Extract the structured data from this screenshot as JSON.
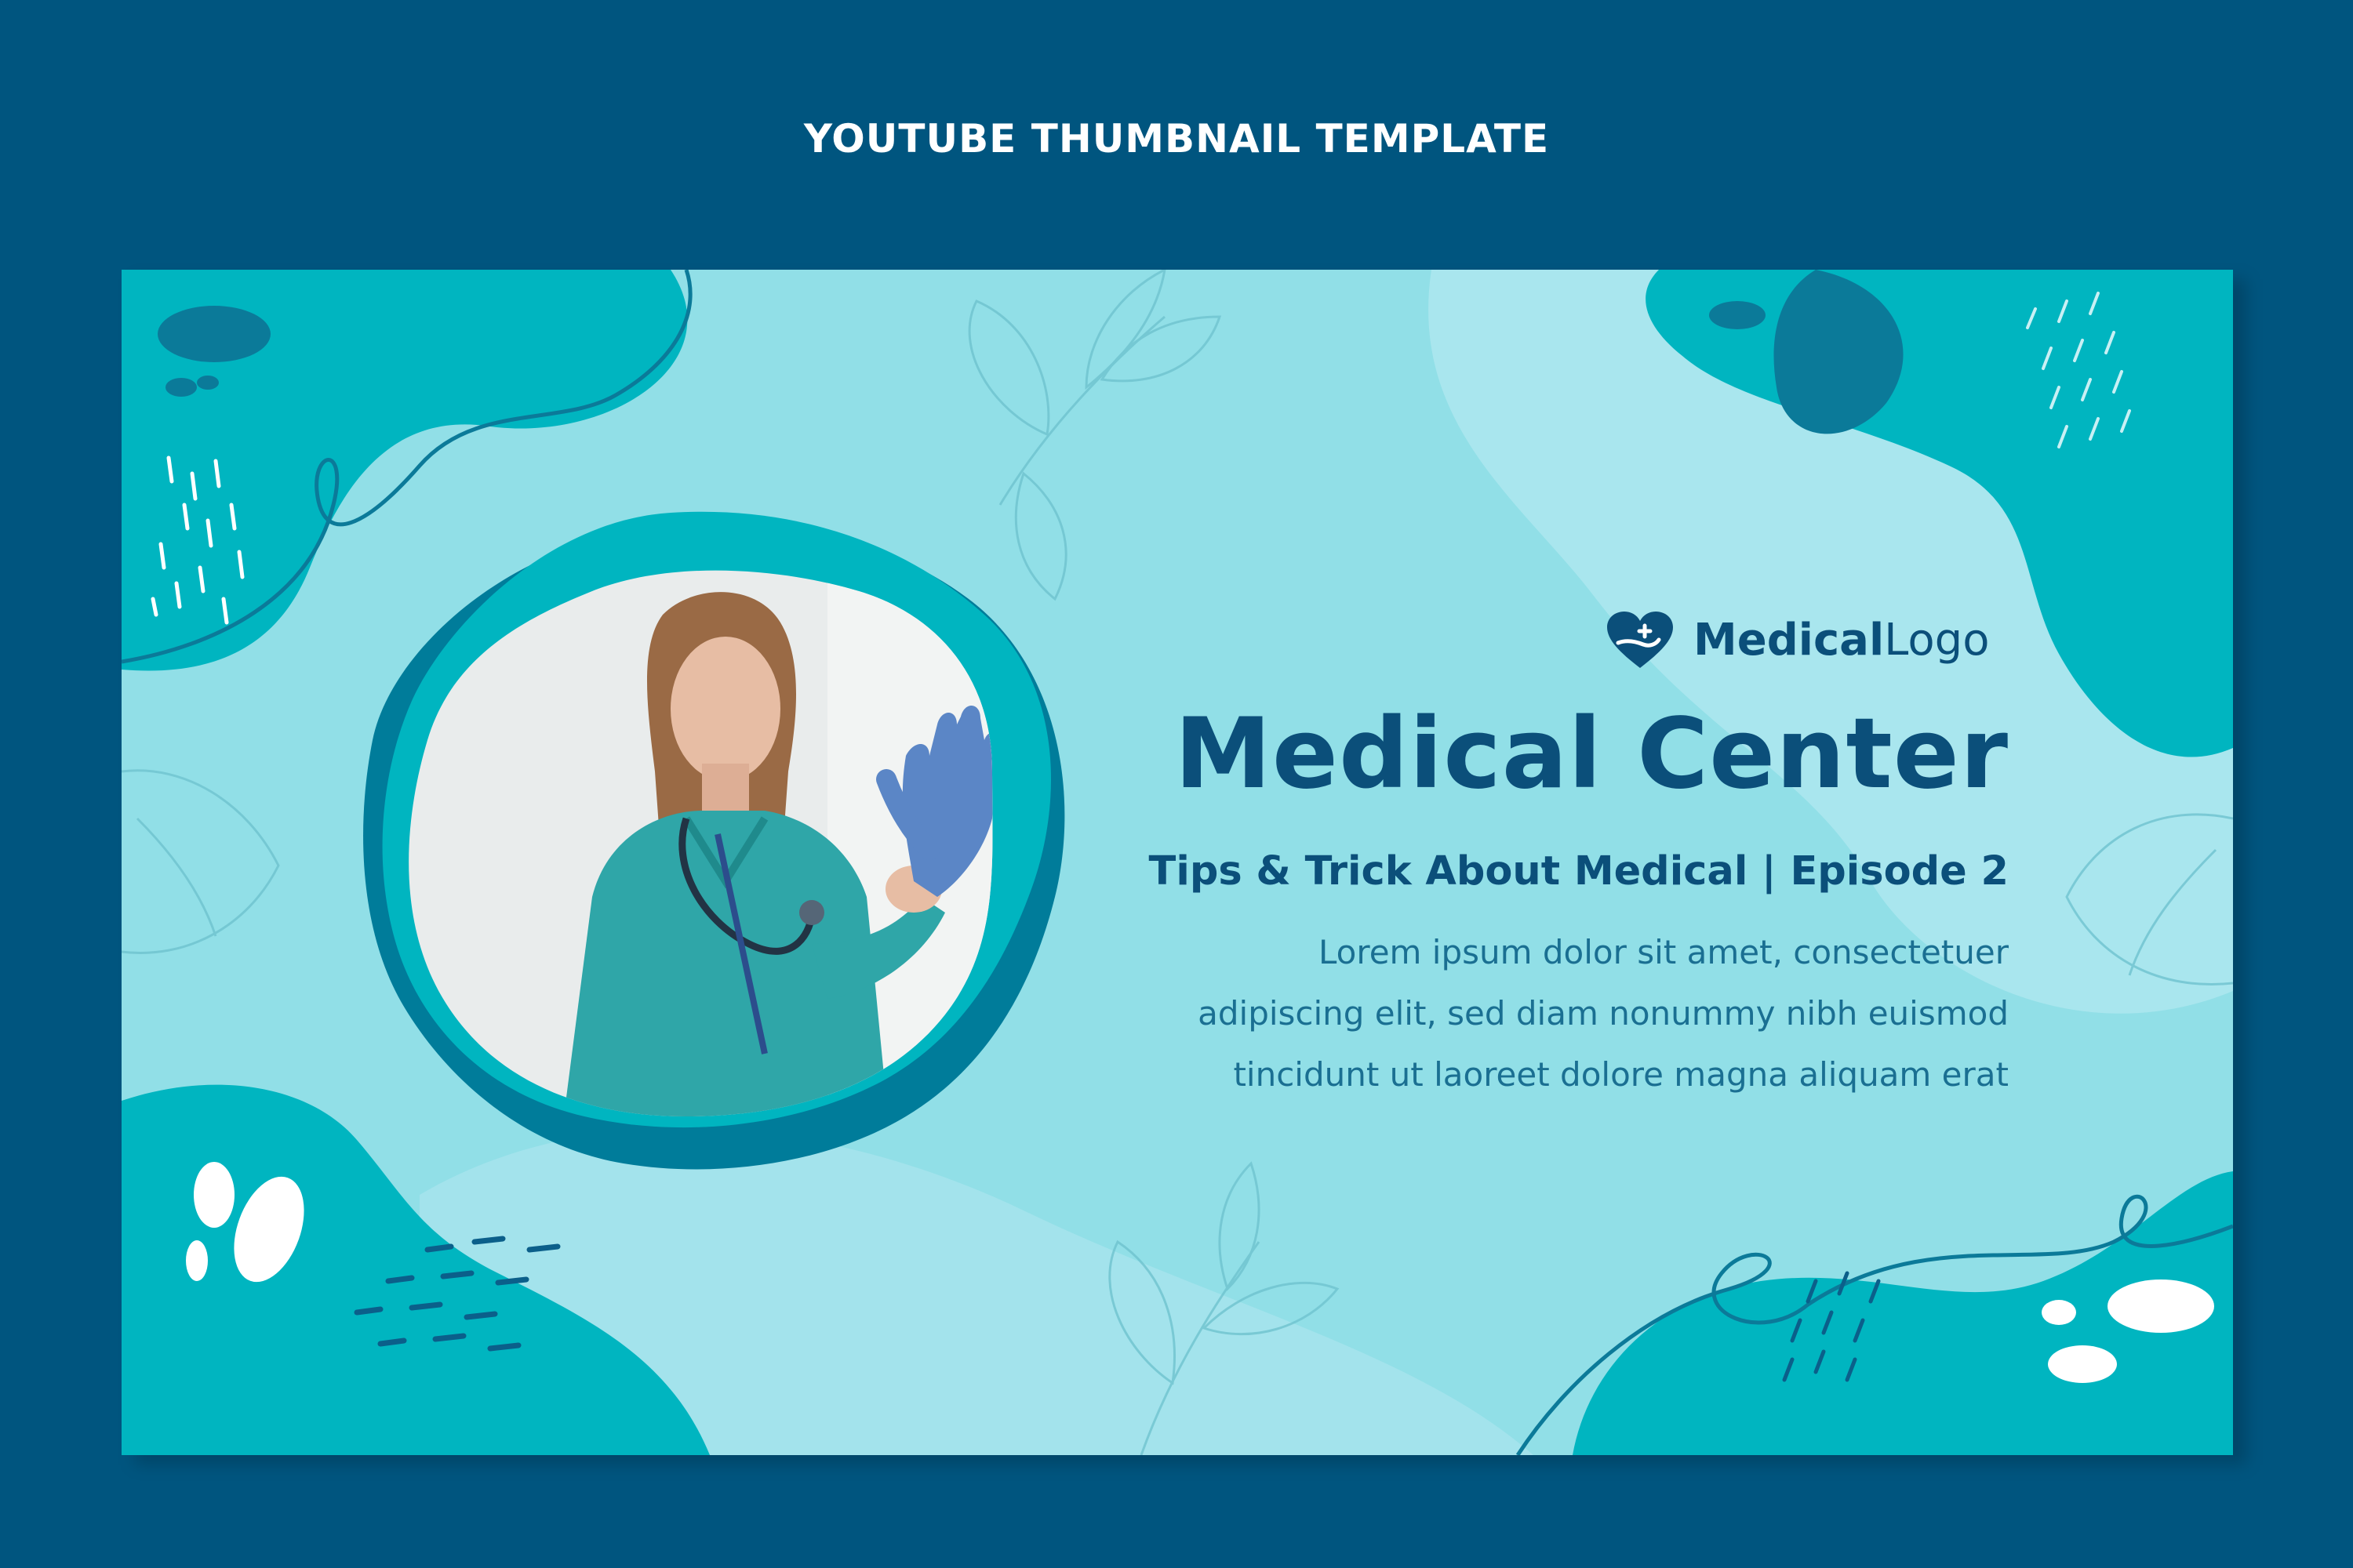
{
  "page": {
    "title": "YOUTUBE THUMBNAIL TEMPLATE",
    "background_color": "#00557f"
  },
  "thumbnail": {
    "logo": {
      "bold_text": "Medical",
      "light_text": "Logo",
      "icon": "heart-hand-icon"
    },
    "headline": "Medical Center",
    "subtitle": "Tips & Trick About Medical | Episode 2",
    "body_lines": [
      "Lorem ipsum dolor sit amet, consectetuer",
      "adipiscing elit, sed diam nonummy nibh euismod",
      "tincidunt ut laoreet dolore magna aliquam erat"
    ],
    "photo_subject": "doctor-in-teal-scrubs-putting-on-gloves"
  },
  "colors": {
    "navy": "#0b4f7a",
    "teal": "#00b5c0",
    "light_teal": "#91dfe7",
    "pale_teal": "#a9e6ee",
    "deep_teal": "#007c9a"
  }
}
